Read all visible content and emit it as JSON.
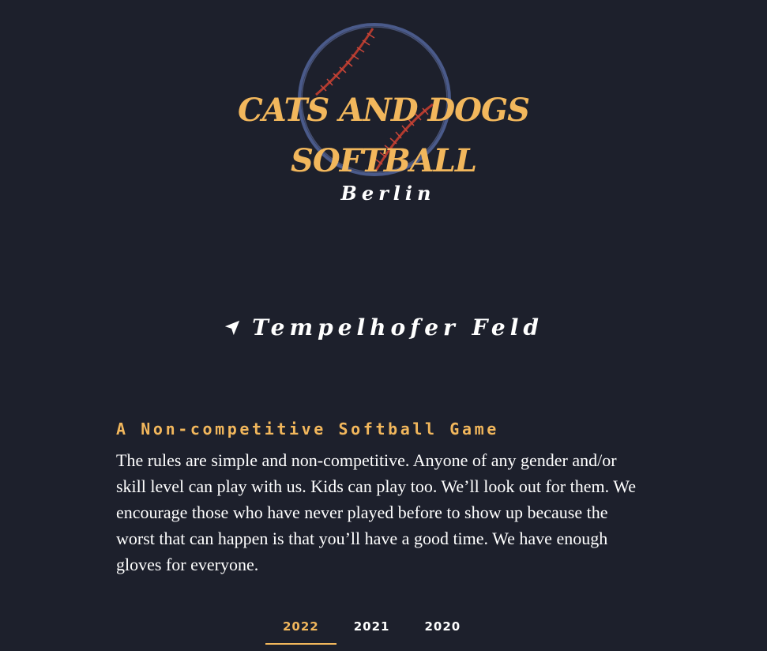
{
  "header": {
    "title_line1": "CATS AND DOGS",
    "title_line2": "SOFTBALL",
    "subtitle": "Berlin",
    "logo_icon": "baseball-icon"
  },
  "location": {
    "icon": "location-arrow-icon",
    "label": "Tempelhofer Feld"
  },
  "intro": {
    "heading": "A Non-competitive Softball Game",
    "text": "The rules are simple and non-competitive. Anyone of any gender and/or skill level can play with us. Kids can play too. We’ll look out for them. We encourage those who have never played before to show up because the worst that can happen is that you’ll have a good time. We have enough gloves for everyone."
  },
  "tabs": [
    {
      "label": "2022",
      "active": true
    },
    {
      "label": "2021",
      "active": false
    },
    {
      "label": "2020",
      "active": false
    }
  ],
  "colors": {
    "background": "#1d202c",
    "accent": "#f2b75c",
    "text": "#ffffff",
    "ball_ring": "#4a5a8a",
    "stitch": "#b23a2e"
  }
}
